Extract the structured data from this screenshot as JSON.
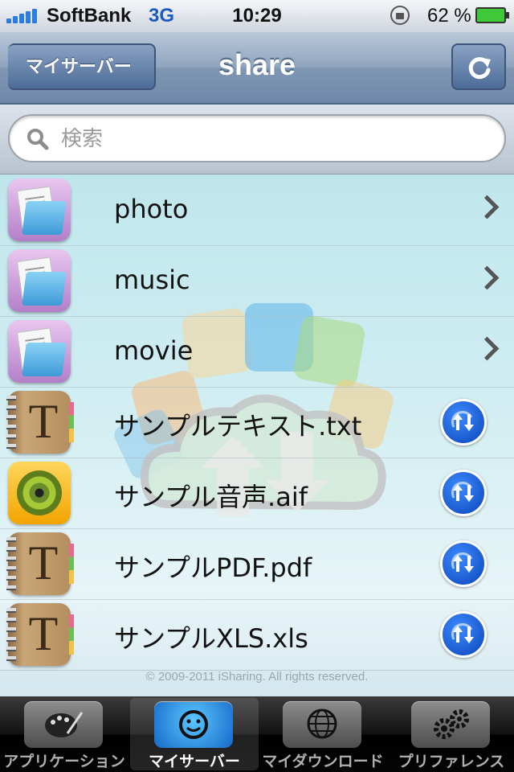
{
  "status_bar": {
    "carrier": "SoftBank",
    "network": "3G",
    "time": "10:29",
    "battery_percent": "62 %",
    "battery_level": 0.62,
    "icons": [
      "signal-bars-icon",
      "rotation-lock-icon",
      "battery-charging-icon"
    ]
  },
  "nav": {
    "back_label": "マイサーバー",
    "title": "share",
    "refresh_icon": "refresh-icon"
  },
  "search": {
    "placeholder": "検索"
  },
  "files": [
    {
      "name": "photo",
      "kind": "folder",
      "accessory": "chevron"
    },
    {
      "name": "music",
      "kind": "folder",
      "accessory": "chevron"
    },
    {
      "name": "movie",
      "kind": "folder",
      "accessory": "chevron"
    },
    {
      "name": "サンプルテキスト.txt",
      "kind": "text",
      "accessory": "transfer"
    },
    {
      "name": "サンプル音声.aif",
      "kind": "audio",
      "accessory": "transfer"
    },
    {
      "name": "サンプルPDF.pdf",
      "kind": "text",
      "accessory": "transfer"
    },
    {
      "name": "サンプルXLS.xls",
      "kind": "text",
      "accessory": "transfer"
    }
  ],
  "footer": {
    "copyright": "© 2009-2011 iSharing. All rights reserved."
  },
  "tabs": [
    {
      "label": "アプリケーション",
      "icon": "palette-icon",
      "active": false
    },
    {
      "label": "マイサーバー",
      "icon": "network-attached-icon",
      "active": true
    },
    {
      "label": "マイダウンロード",
      "icon": "globe-download-icon",
      "active": false
    },
    {
      "label": "プリファレンス",
      "icon": "gears-icon",
      "active": false
    }
  ],
  "colors": {
    "nav_bar": "#8ea4bd",
    "transfer_button": "#1a5fd6",
    "tab_active": "#2b8fe6"
  }
}
